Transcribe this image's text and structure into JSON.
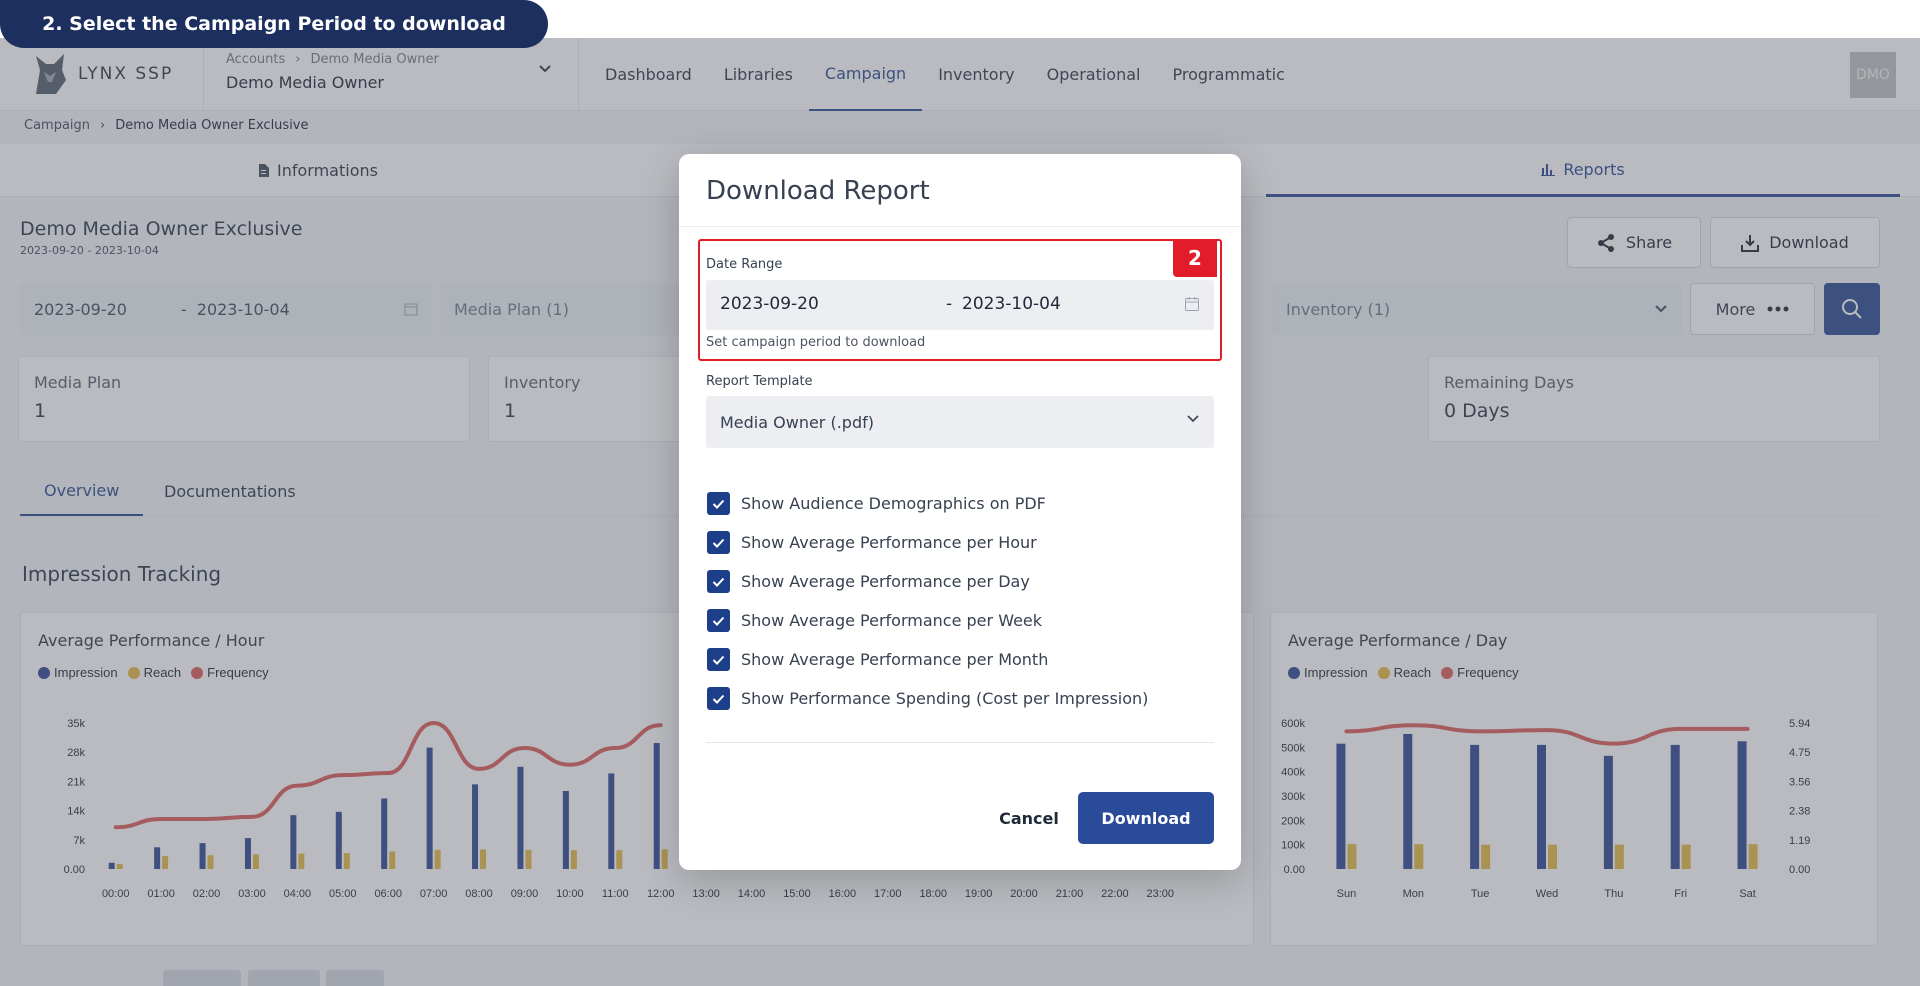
{
  "step_banner": "2. Select the Campaign Period to download",
  "brand": {
    "name": "LYNX SSP"
  },
  "account": {
    "crumbs": [
      "Accounts",
      "Demo Media Owner"
    ],
    "name": "Demo Media Owner"
  },
  "nav": {
    "items": [
      "Dashboard",
      "Libraries",
      "Campaign",
      "Inventory",
      "Operational",
      "Programmatic"
    ],
    "active": "Campaign"
  },
  "avatar": "DMO",
  "breadcrumb": {
    "parent": "Campaign",
    "current": "Demo Media Owner Exclusive"
  },
  "section_tabs": {
    "informations": "Informations",
    "reports": "Reports"
  },
  "campaign": {
    "title": "Demo Media Owner Exclusive",
    "dates": "2023-09-20 - 2023-10-04"
  },
  "header_buttons": {
    "share": "Share",
    "download": "Download"
  },
  "filters": {
    "start": "2023-09-20",
    "dash": "-",
    "end": "2023-10-04",
    "media_plan": "Media Plan (1)",
    "inventory": "Inventory (1)",
    "more": "More"
  },
  "stats": [
    {
      "label": "Media Plan",
      "value": "1"
    },
    {
      "label": "Inventory",
      "value": "1"
    },
    {
      "label": "Remaining Days",
      "value": "0 Days"
    }
  ],
  "content_tabs": [
    "Overview",
    "Documentations"
  ],
  "impression_tracking": "Impression Tracking",
  "legend": {
    "impression": "Impression",
    "reach": "Reach",
    "frequency": "Frequency"
  },
  "colors": {
    "impression": "#1f3b8a",
    "reach": "#e3b43a",
    "frequency": "#d9534f",
    "primary": "#1d3f8a",
    "highlight": "#e11d2a"
  },
  "chart_data": [
    {
      "type": "bar",
      "title": "Average Performance / Hour",
      "categories": [
        "00:00",
        "01:00",
        "02:00",
        "03:00",
        "04:00",
        "05:00",
        "06:00",
        "07:00",
        "08:00",
        "09:00",
        "10:00",
        "11:00",
        "12:00",
        "13:00",
        "14:00",
        "15:00",
        "16:00",
        "17:00",
        "18:00",
        "19:00",
        "20:00",
        "21:00",
        "22:00",
        "23:00"
      ],
      "y_ticks": [
        "35k",
        "28k",
        "21k",
        "14k",
        "7k",
        "0.00"
      ],
      "ylim": [
        0,
        35000
      ],
      "series": [
        {
          "name": "Impression",
          "values": [
            1500,
            5200,
            6200,
            7400,
            12900,
            13700,
            16900,
            29100,
            20300,
            24500,
            18700,
            22900,
            30200,
            0,
            0,
            0,
            0,
            0,
            0,
            0,
            0,
            0,
            0,
            0
          ]
        },
        {
          "name": "Reach",
          "values": [
            1200,
            3100,
            3300,
            3500,
            3700,
            3800,
            4200,
            4600,
            4700,
            4600,
            4500,
            4500,
            4700,
            0,
            0,
            0,
            0,
            0,
            0,
            0,
            0,
            0,
            0,
            0
          ]
        },
        {
          "name": "Frequency",
          "values": [
            10000,
            12000,
            12000,
            12500,
            20000,
            22500,
            23000,
            35000,
            24000,
            29000,
            25000,
            29000,
            34500,
            null,
            null,
            null,
            null,
            null,
            null,
            null,
            null,
            null,
            null,
            null
          ]
        }
      ]
    },
    {
      "type": "bar",
      "title": "Average Performance / Day",
      "categories": [
        "Sun",
        "Mon",
        "Tue",
        "Wed",
        "Thu",
        "Fri",
        "Sat"
      ],
      "y_ticks": [
        "600k",
        "500k",
        "400k",
        "300k",
        "200k",
        "100k",
        "0.00"
      ],
      "y2_ticks": [
        "5.94",
        "4.75",
        "3.56",
        "2.38",
        "1.19",
        "0.00"
      ],
      "ylim": [
        0,
        600000
      ],
      "y2lim": [
        0,
        5.94
      ],
      "series": [
        {
          "name": "Impression",
          "values": [
            515000,
            555000,
            510000,
            510000,
            465000,
            510000,
            525000
          ]
        },
        {
          "name": "Reach",
          "values": [
            102000,
            102000,
            100000,
            100000,
            100000,
            100000,
            102000
          ]
        },
        {
          "name": "Frequency",
          "values": [
            5.6,
            5.85,
            5.6,
            5.65,
            5.1,
            5.7,
            5.7
          ]
        }
      ]
    }
  ],
  "modal": {
    "title": "Download Report",
    "date_range_label": "Date Range",
    "start": "2023-09-20",
    "dash": "-",
    "end": "2023-10-04",
    "help": "Set campaign period to download",
    "step_badge": "2",
    "template_label": "Report Template",
    "template_value": "Media Owner (.pdf)",
    "options": [
      "Show Audience Demographics on PDF",
      "Show Average Performance per Hour",
      "Show Average Performance per Day",
      "Show Average Performance per Week",
      "Show Average Performance per Month",
      "Show Performance Spending (Cost per Impression)"
    ],
    "cancel": "Cancel",
    "download": "Download"
  }
}
